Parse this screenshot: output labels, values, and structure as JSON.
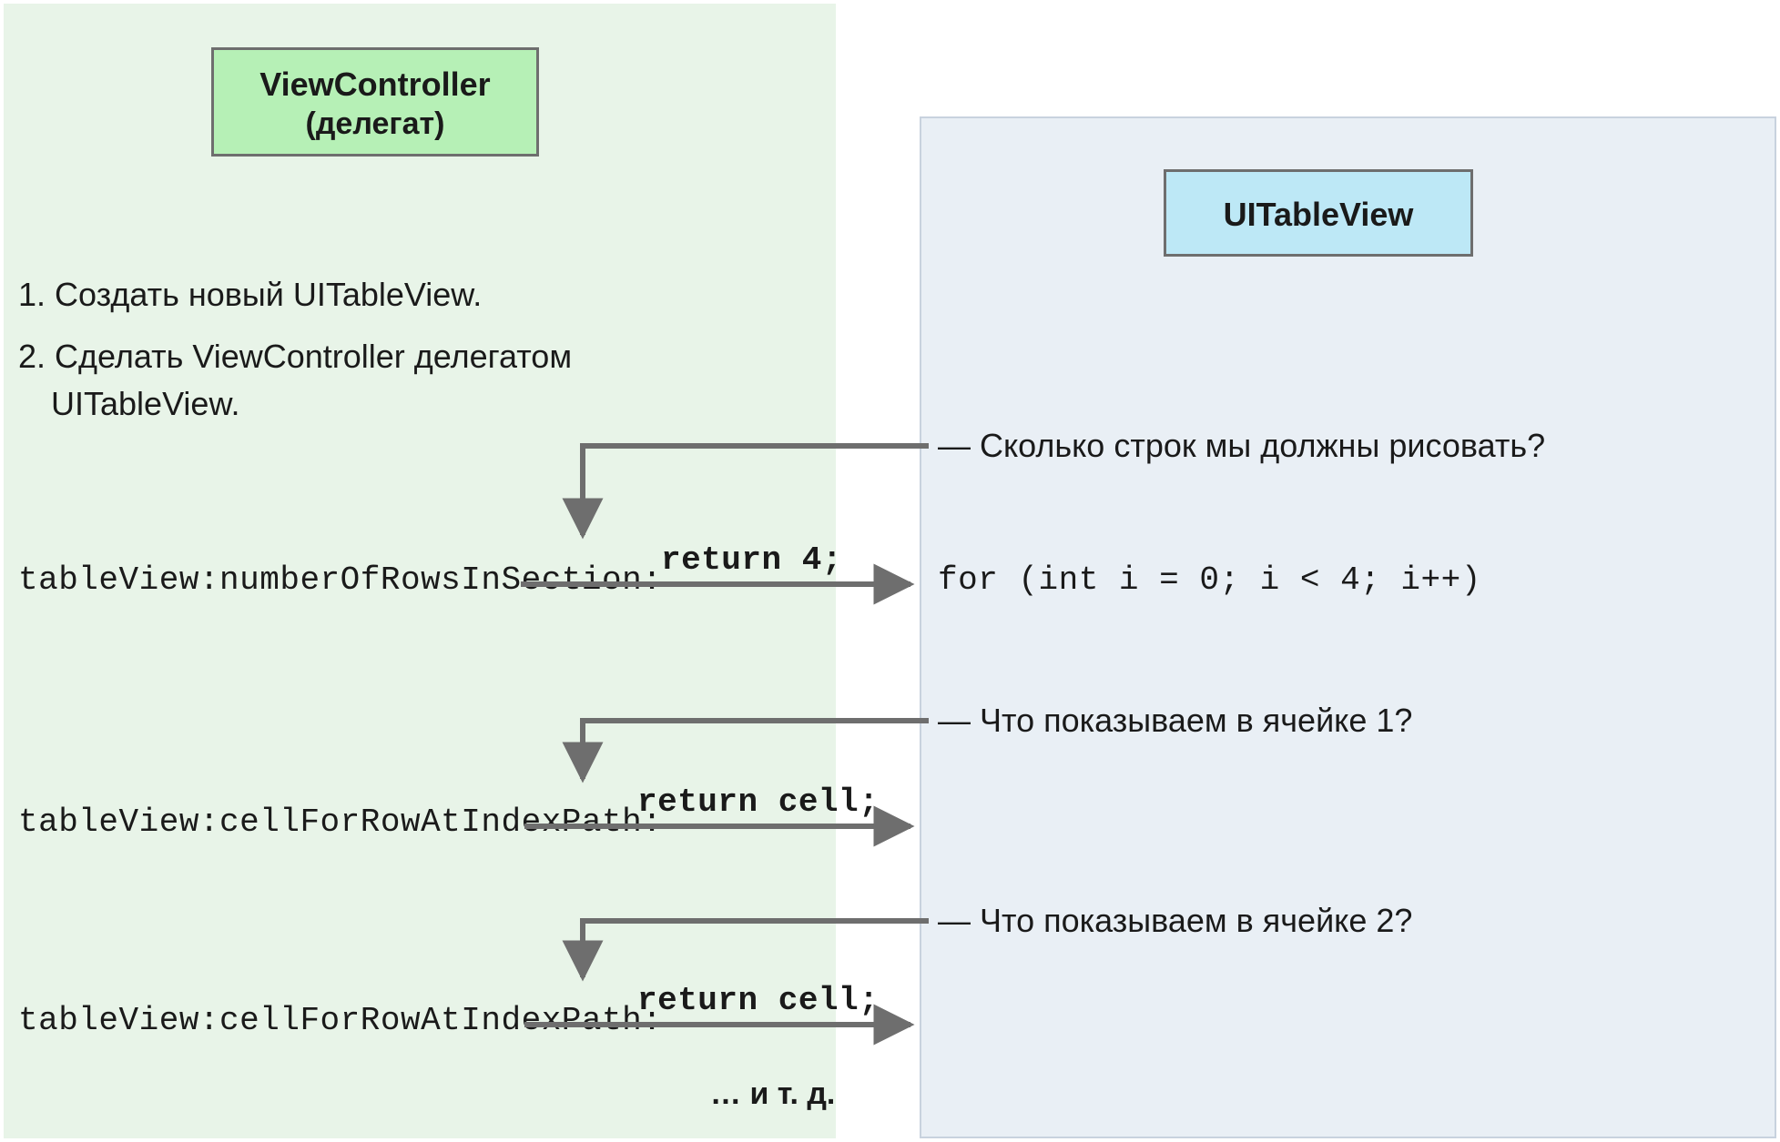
{
  "left_panel": {
    "title_line1": "ViewController",
    "title_line2": "(делегат)",
    "step1": "1.  Создать новый UITableView.",
    "step2_l1": "2. Сделать ViewController делегатом",
    "step2_l2": "UITableView.",
    "call1": "tableView:numberOfRowsInSection:",
    "ret1": "return 4;",
    "call2": "tableView:cellForRowAtIndexPath:",
    "ret2": "return cell;",
    "call3": "tableView:cellForRowAtIndexPath:",
    "ret3": "return cell;",
    "etc": "… и т. д."
  },
  "right_panel": {
    "title": "UITableView",
    "q1": "— Сколько строк мы должны рисовать?",
    "loop": "for (int i = 0; i < 4; i++)",
    "q2": "— Что показываем в ячейке 1?",
    "q3": "— Что показываем в ячейке 2?"
  },
  "colors": {
    "arrow": "#6e6e6e",
    "left_bg": "#e8f4e8",
    "right_bg": "#e9eff5",
    "green_box": "#b6f0b6",
    "blue_box": "#bde8f6"
  }
}
